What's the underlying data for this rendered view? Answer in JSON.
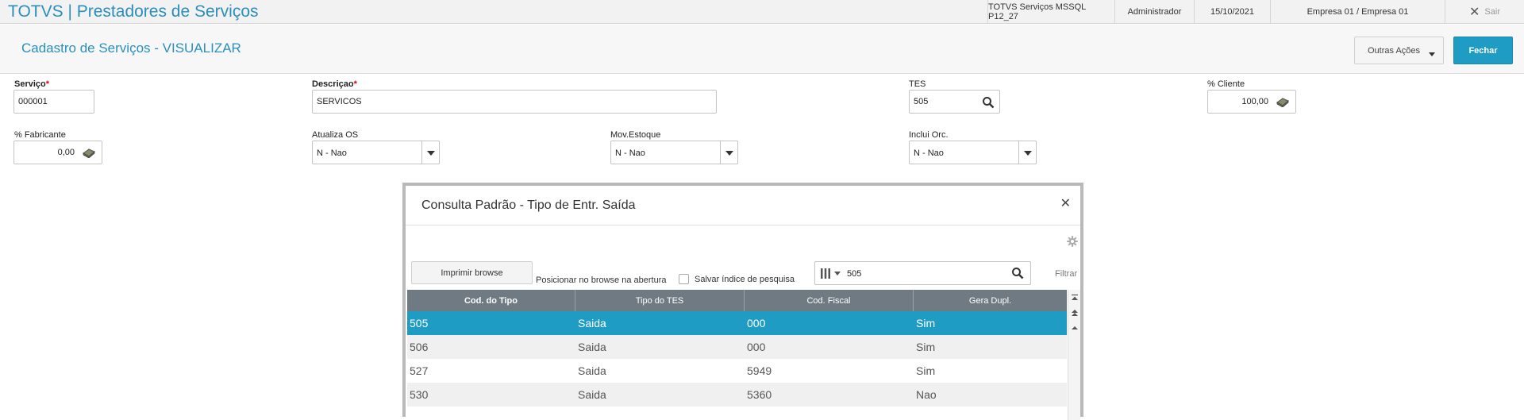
{
  "topbar": {
    "title": "TOTVS | Prestadores de Serviços",
    "environment": "TOTVS Serviços MSSQL P12_27",
    "user": "Administrador",
    "date": "15/10/2021",
    "company": "Empresa 01 / Empresa 01",
    "exit_label": "Sair"
  },
  "header": {
    "title": "Cadastro de Serviços - VISUALIZAR",
    "other_actions_label": "Outras Ações",
    "close_label": "Fechar"
  },
  "form": {
    "servico": {
      "label": "Serviço",
      "value": "000001"
    },
    "descricao": {
      "label": "Descriçao",
      "value": "SERVICOS"
    },
    "tes": {
      "label": "TES",
      "value": "505"
    },
    "pct_cliente": {
      "label": "% Cliente",
      "value": "100,00"
    },
    "pct_fabricante": {
      "label": "% Fabricante",
      "value": "0,00"
    },
    "atualiza_os": {
      "label": "Atualiza OS",
      "value": "N - Nao"
    },
    "mov_estoque": {
      "label": "Mov.Estoque",
      "value": "N - Nao"
    },
    "inclui_orc": {
      "label": "Inclui Orc.",
      "value": "N - Nao"
    }
  },
  "dialog": {
    "title": "Consulta Padrão - Tipo de Entr. Saída",
    "print_button": "Imprimir browse",
    "position_label": "Posicionar no browse na abertura",
    "save_index_label": "Salvar índice de pesquisa",
    "search_value": "505",
    "filter_label": "Filtrar",
    "columns": [
      "Cod. do Tipo",
      "Tipo do TES",
      "Cod. Fiscal",
      "Gera Dupl."
    ],
    "rows": [
      [
        "505",
        "Saida",
        "000",
        "Sim"
      ],
      [
        "506",
        "Saida",
        "000",
        "Sim"
      ],
      [
        "527",
        "Saida",
        "5949",
        "Sim"
      ],
      [
        "530",
        "Saida",
        "5360",
        "Nao"
      ]
    ],
    "selected_row": 0
  },
  "colors": {
    "accent": "#1f9cc4",
    "title_blue": "#2a8fbd",
    "grid_header": "#6f7a83",
    "required": "#d0021b"
  }
}
